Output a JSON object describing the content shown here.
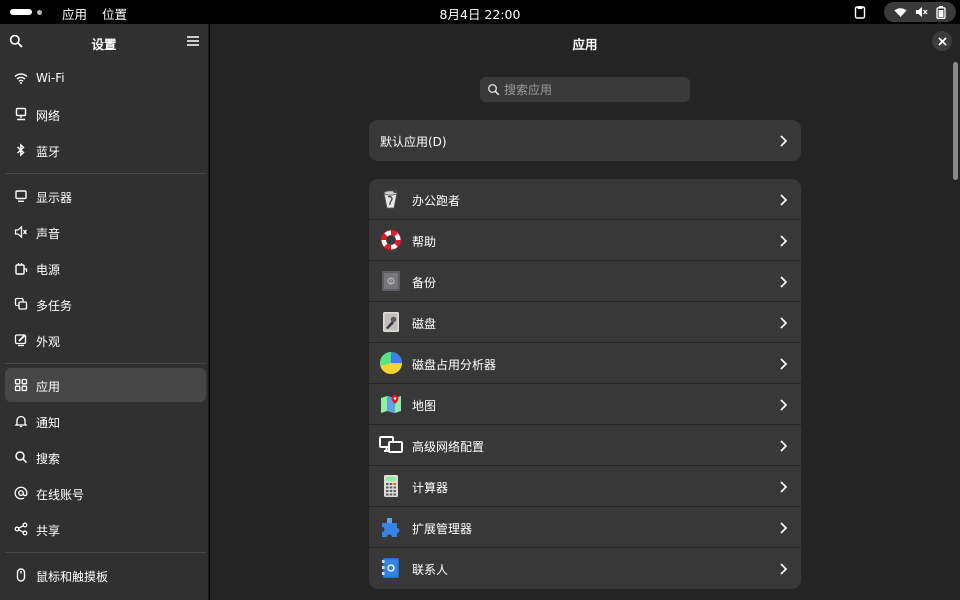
{
  "topbar": {
    "menu_apps": "应用",
    "menu_places": "位置",
    "clock": "8月4日  22:00",
    "status_icons": [
      "wifi-icon",
      "speaker-muted-icon",
      "battery-icon"
    ]
  },
  "sidebar": {
    "title": "设置",
    "groups": [
      [
        {
          "label": "Wi-Fi",
          "icon": "wifi-icon"
        },
        {
          "label": "网络",
          "icon": "network-icon"
        },
        {
          "label": "蓝牙",
          "icon": "bluetooth-icon"
        }
      ],
      [
        {
          "label": "显示器",
          "icon": "display-icon"
        },
        {
          "label": "声音",
          "icon": "sound-icon"
        },
        {
          "label": "电源",
          "icon": "power-icon"
        },
        {
          "label": "多任务",
          "icon": "multitasking-icon"
        },
        {
          "label": "外观",
          "icon": "appearance-icon"
        }
      ],
      [
        {
          "label": "应用",
          "icon": "apps-icon",
          "selected": true
        },
        {
          "label": "通知",
          "icon": "bell-icon"
        },
        {
          "label": "搜索",
          "icon": "search-icon"
        },
        {
          "label": "在线账号",
          "icon": "at-icon"
        },
        {
          "label": "共享",
          "icon": "share-icon"
        }
      ],
      [
        {
          "label": "鼠标和触摸板",
          "icon": "mouse-icon"
        }
      ]
    ]
  },
  "main": {
    "title": "应用",
    "search_placeholder": "搜索应用",
    "default_apps": "默认应用(D)",
    "apps": [
      {
        "label": "办公跑者",
        "icon": "office-runner-icon"
      },
      {
        "label": "帮助",
        "icon": "help-lifebuoy-icon"
      },
      {
        "label": "备份",
        "icon": "backup-safe-icon"
      },
      {
        "label": "磁盘",
        "icon": "disks-icon"
      },
      {
        "label": "磁盘占用分析器",
        "icon": "disk-usage-pie-icon"
      },
      {
        "label": "地图",
        "icon": "maps-icon"
      },
      {
        "label": "高级网络配置",
        "icon": "network-config-icon"
      },
      {
        "label": "计算器",
        "icon": "calculator-icon"
      },
      {
        "label": "扩展管理器",
        "icon": "extensions-puzzle-icon"
      },
      {
        "label": "联系人",
        "icon": "contacts-icon"
      }
    ]
  },
  "colors": {
    "accent_yellow": "#f6d32d",
    "lifebuoy_red": "#e01b24",
    "blue": "#3584e4"
  }
}
